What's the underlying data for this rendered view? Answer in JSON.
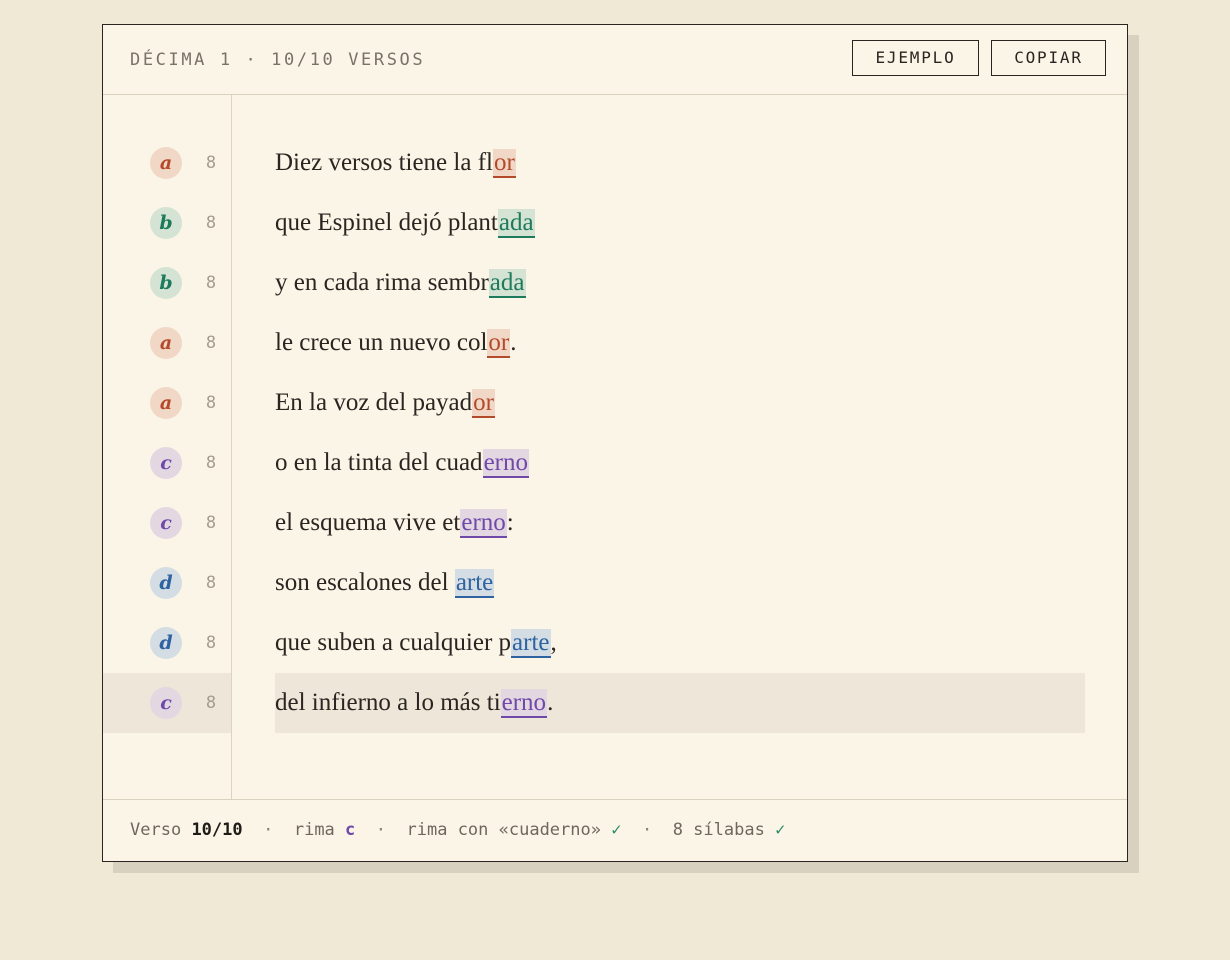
{
  "header": {
    "title": "DÉCIMA 1 · 10/10 VERSOS",
    "buttons": {
      "example": "EJEMPLO",
      "copy": "COPIAR"
    }
  },
  "scheme_colors": {
    "a": {
      "fg": "#b34a2a",
      "bg": "#f1d7c6"
    },
    "b": {
      "fg": "#1e7a5c",
      "bg": "#d4e3d3"
    },
    "c": {
      "fg": "#7048a8",
      "bg": "#e3d7e2"
    },
    "d": {
      "fg": "#2e62a0",
      "bg": "#d3dde3"
    }
  },
  "verses": [
    {
      "rhyme": "a",
      "syllables": "8",
      "before": "Diez versos tiene la fl",
      "rime": "or",
      "after": ""
    },
    {
      "rhyme": "b",
      "syllables": "8",
      "before": "que Espinel dejó plant",
      "rime": "ada",
      "after": ""
    },
    {
      "rhyme": "b",
      "syllables": "8",
      "before": "y en cada rima sembr",
      "rime": "ada",
      "after": ""
    },
    {
      "rhyme": "a",
      "syllables": "8",
      "before": "le crece un nuevo col",
      "rime": "or",
      "after": "."
    },
    {
      "rhyme": "a",
      "syllables": "8",
      "before": "En la voz del payad",
      "rime": "or",
      "after": ""
    },
    {
      "rhyme": "c",
      "syllables": "8",
      "before": "o en la tinta del cuad",
      "rime": "erno",
      "after": ""
    },
    {
      "rhyme": "c",
      "syllables": "8",
      "before": "el esquema vive et",
      "rime": "erno",
      "after": ":"
    },
    {
      "rhyme": "d",
      "syllables": "8",
      "before": "son escalones del ",
      "rime": "arte",
      "after": ""
    },
    {
      "rhyme": "d",
      "syllables": "8",
      "before": "que suben a cualquier p",
      "rime": "arte",
      "after": ","
    },
    {
      "rhyme": "c",
      "syllables": "8",
      "before": "del infierno a lo más ti",
      "rime": "erno",
      "after": ".",
      "active": true
    }
  ],
  "footer": {
    "verse_label": "Verso",
    "verse_count": "10/10",
    "sep": "·",
    "rhyme_label": "rima",
    "rhyme_letter": "c",
    "rhymes_with": "rima con «cuaderno»",
    "syllables": "8 sílabas",
    "check": "✓"
  }
}
